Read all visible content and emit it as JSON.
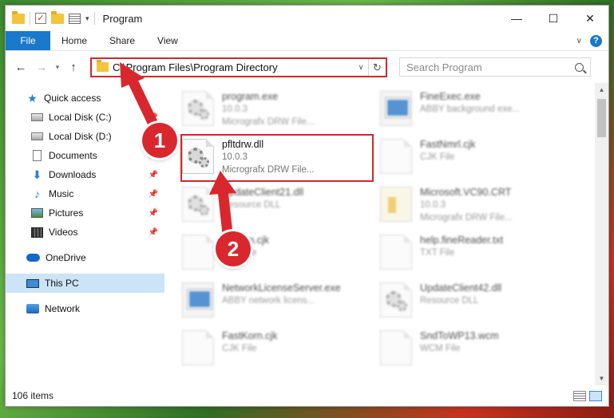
{
  "window": {
    "title": "Program",
    "controls": {
      "minimize": "—",
      "maximize": "☐",
      "close": "✕"
    }
  },
  "ribbon": {
    "tabs": [
      "File",
      "Home",
      "Share",
      "View"
    ],
    "help": "?"
  },
  "address": {
    "path": "C:\\Program Files\\Program Directory",
    "search_placeholder": "Search Program"
  },
  "sidebar": {
    "quick_access": "Quick access",
    "items": [
      {
        "label": "Local Disk (C:)",
        "icon": "disk-icon",
        "pinned": true
      },
      {
        "label": "Local Disk (D:)",
        "icon": "disk-icon",
        "pinned": false
      },
      {
        "label": "Documents",
        "icon": "documents-icon",
        "pinned": true
      },
      {
        "label": "Downloads",
        "icon": "downloads-icon",
        "pinned": true
      },
      {
        "label": "Music",
        "icon": "music-icon",
        "pinned": true
      },
      {
        "label": "Pictures",
        "icon": "pictures-icon",
        "pinned": true
      },
      {
        "label": "Videos",
        "icon": "videos-icon",
        "pinned": true
      }
    ],
    "onedrive": "OneDrive",
    "this_pc": "This PC",
    "network": "Network"
  },
  "files": [
    {
      "name": "program.exe",
      "line2": "10.0.3",
      "line3": "Micrografx DRW File...",
      "kind": "gear",
      "blurred": true
    },
    {
      "name": "FineExec.exe",
      "line2": "ABBY background exe...",
      "line3": "",
      "kind": "exe",
      "blurred": true
    },
    {
      "name": "pfltdrw.dll",
      "line2": "10.0.3",
      "line3": "Micrografx DRW File...",
      "kind": "gear",
      "blurred": false
    },
    {
      "name": "FastNmrl.cjk",
      "line2": "CJK File",
      "line3": "",
      "kind": "page",
      "blurred": true
    },
    {
      "name": "UpdateClient21.dll",
      "line2": "Resource DLL",
      "line3": "",
      "kind": "gear",
      "blurred": true
    },
    {
      "name": "Microsoft.VC90.CRT",
      "line2": "10.0.3",
      "line3": "Micrografx DRW File...",
      "kind": "crt",
      "blurred": true
    },
    {
      "name": "Korean.cjk",
      "line2": "CJK File",
      "line3": "",
      "kind": "page",
      "blurred": true
    },
    {
      "name": "help.fineReader.txt",
      "line2": "TXT File",
      "line3": "",
      "kind": "page",
      "blurred": true
    },
    {
      "name": "NetworkLicenseServer.exe",
      "line2": "ABBY network licens...",
      "line3": "",
      "kind": "exe",
      "blurred": true
    },
    {
      "name": "UpdateClient42.dll",
      "line2": "Resource DLL",
      "line3": "",
      "kind": "gear",
      "blurred": true
    },
    {
      "name": "FastKorn.cjk",
      "line2": "CJK File",
      "line3": "",
      "kind": "page",
      "blurred": true
    },
    {
      "name": "SndToWP13.wcm",
      "line2": "WCM File",
      "line3": "",
      "kind": "page",
      "blurred": true
    }
  ],
  "status": {
    "count": "106 items"
  },
  "annotations": {
    "step1": "1",
    "step2": "2"
  },
  "colors": {
    "accent": "#1979ca",
    "highlight": "#d6262d",
    "selected": "#cce4f7"
  }
}
